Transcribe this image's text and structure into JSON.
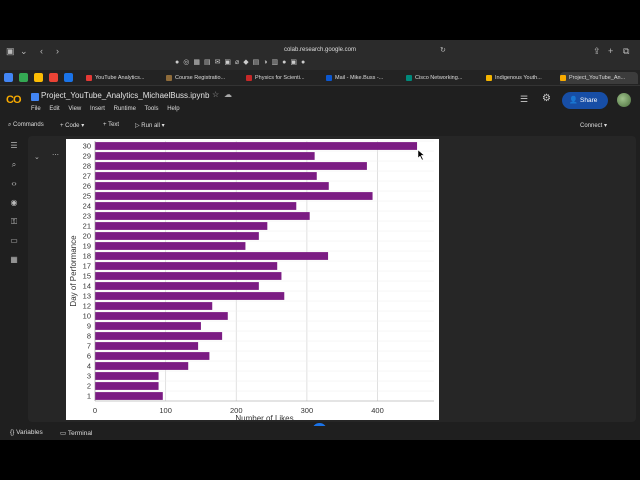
{
  "browser": {
    "address": "colab.research.google.com",
    "tabs": [
      {
        "label": "YouTube Analytics...",
        "color": "#e53935"
      },
      {
        "label": "Course Registratio...",
        "color": "#8e6b3a"
      },
      {
        "label": "Physics for Scienti...",
        "color": "#c62828"
      },
      {
        "label": "Mail - Mike.Buss -...",
        "color": "#0b57d0"
      },
      {
        "label": "Cisco Networking...",
        "color": "#00897b"
      },
      {
        "label": "Indigenous Youth...",
        "color": "#f4b400"
      },
      {
        "label": "Project_YouTube_An...",
        "color": "#f9ab00"
      }
    ]
  },
  "colab": {
    "logo": "CO",
    "notebook_title": "Project_YouTube_Analytics_MichaelBuss.ipynb",
    "menu": [
      "File",
      "Edit",
      "View",
      "Insert",
      "Runtime",
      "Tools",
      "Help"
    ],
    "share_label": "Share",
    "toolbar": {
      "commands": "Commands",
      "code": "+ Code",
      "text": "+ Text",
      "run_all": "Run all",
      "connect": "Connect"
    },
    "status": {
      "variables": "Variables",
      "terminal": "Terminal"
    }
  },
  "chart_data": {
    "type": "bar",
    "orientation": "horizontal",
    "categories": [
      "1",
      "2",
      "3",
      "4",
      "6",
      "7",
      "8",
      "9",
      "10",
      "12",
      "13",
      "14",
      "15",
      "17",
      "18",
      "19",
      "20",
      "21",
      "23",
      "24",
      "25",
      "26",
      "27",
      "28",
      "29",
      "30"
    ],
    "values": [
      96,
      90,
      90,
      132,
      162,
      146,
      180,
      150,
      188,
      166,
      268,
      232,
      264,
      258,
      330,
      213,
      232,
      244,
      304,
      285,
      393,
      331,
      314,
      385,
      311,
      456
    ],
    "bar_color": "#7b1c83",
    "xlabel": "Number of Likes",
    "ylabel": "Day of Performance",
    "xticks": [
      0,
      100,
      200,
      300,
      400
    ],
    "xlim": [
      0,
      480
    ],
    "grid": "vertical"
  }
}
